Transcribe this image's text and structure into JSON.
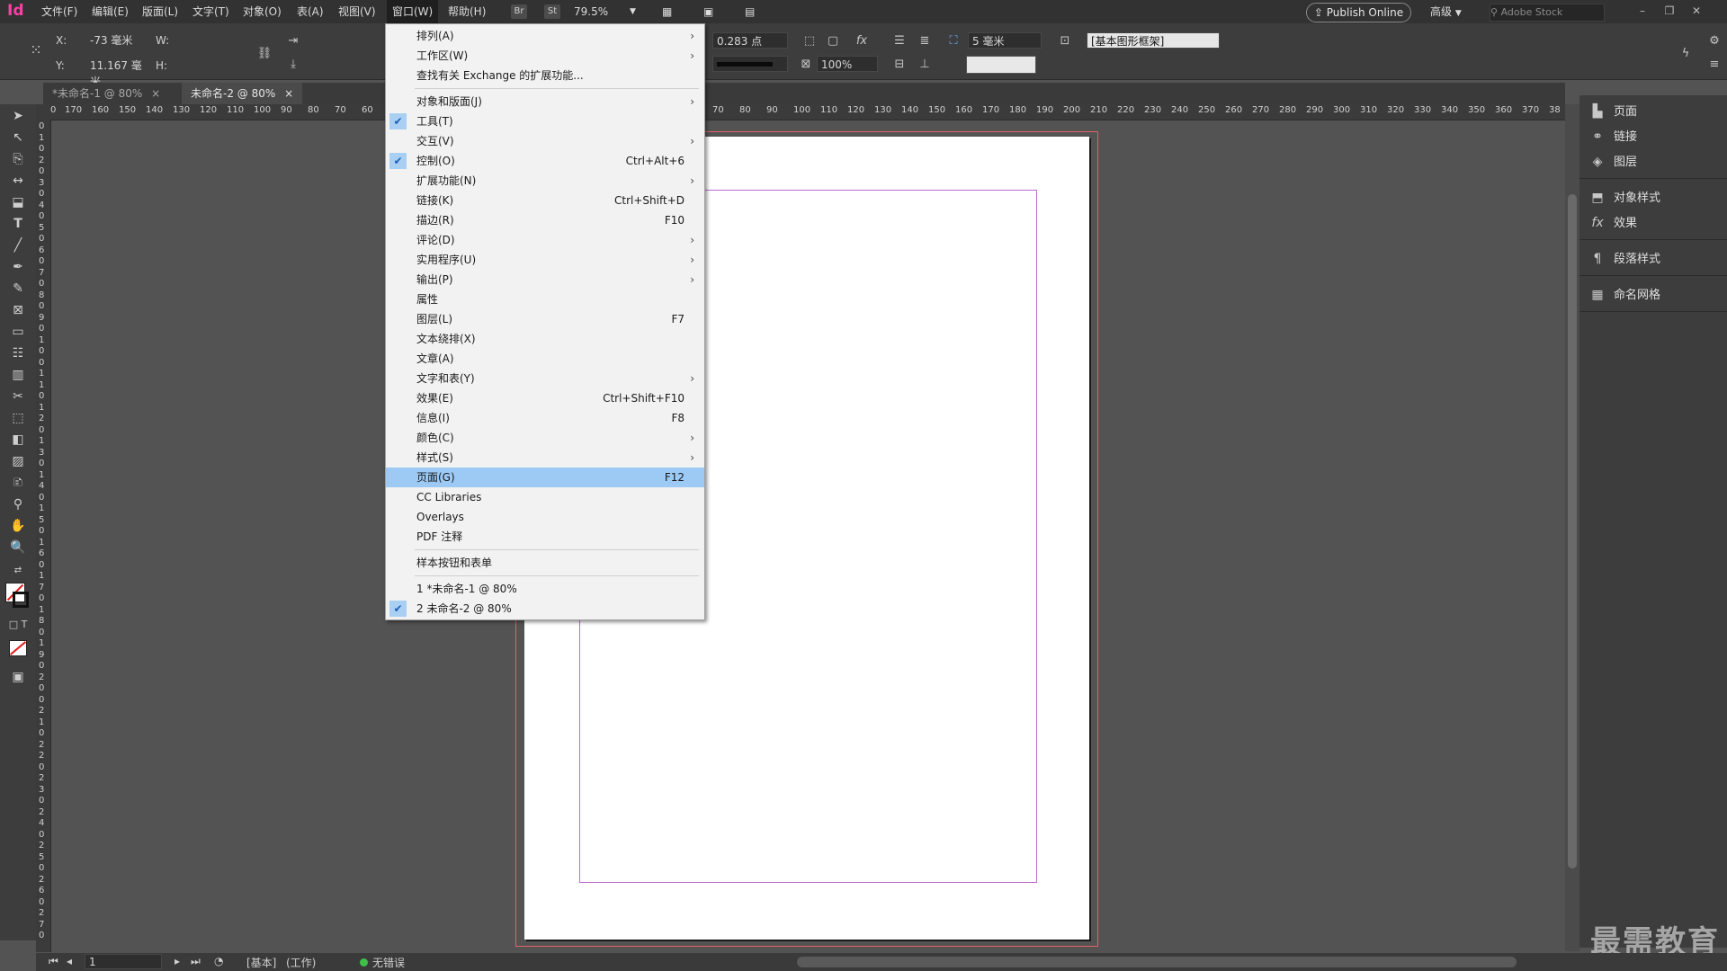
{
  "app": {
    "logo": "Id",
    "menus": [
      "文件(F)",
      "编辑(E)",
      "版面(L)",
      "文字(T)",
      "对象(O)",
      "表(A)",
      "视图(V)",
      "窗口(W)",
      "帮助(H)"
    ],
    "br": "Br",
    "st": "St",
    "zoom": "79.5%",
    "publish_online": "Publish Online",
    "workspace": "高级",
    "search_placeholder": "Adobe Stock"
  },
  "control": {
    "x_label": "X:",
    "x_value": "-73 毫米",
    "y_label": "Y:",
    "y_value": "11.167 毫米",
    "w_label": "W:",
    "h_label": "H:",
    "stroke_weight": "0.283 点",
    "opacity": "100%",
    "offset": "5 毫米",
    "frame_style": "[基本图形框架]"
  },
  "tabs": [
    {
      "label": "*未命名-1 @ 80%",
      "close": "×"
    },
    {
      "label": "未命名-2 @ 80%",
      "close": "×"
    }
  ],
  "ruler_h": [
    "0",
    "170",
    "160",
    "150",
    "140",
    "130",
    "120",
    "110",
    "100",
    "90",
    "80",
    "70",
    "60",
    "70",
    "80",
    "90",
    "100",
    "110",
    "120",
    "130",
    "140",
    "150",
    "160",
    "170",
    "180",
    "190",
    "200",
    "210",
    "220",
    "230",
    "240",
    "250",
    "260",
    "270",
    "280",
    "290",
    "300",
    "310",
    "320",
    "330",
    "340",
    "350",
    "360",
    "370",
    "38"
  ],
  "ruler_v": [
    "0",
    "1",
    "0",
    "2",
    "0",
    "3",
    "0",
    "4",
    "0",
    "5",
    "0",
    "6",
    "0",
    "7",
    "0",
    "8",
    "0",
    "9",
    "0",
    "1",
    "0",
    "0",
    "1",
    "1",
    "0",
    "1",
    "2",
    "0",
    "1",
    "3",
    "0",
    "1",
    "4",
    "0",
    "1",
    "5",
    "0",
    "1",
    "6",
    "0",
    "1",
    "7",
    "0",
    "1",
    "8",
    "0",
    "1",
    "9",
    "0",
    "2",
    "0",
    "0",
    "2",
    "1",
    "0",
    "2",
    "2",
    "0",
    "2",
    "3",
    "0",
    "2",
    "4",
    "0",
    "2",
    "5",
    "0",
    "2",
    "6",
    "0",
    "2",
    "7",
    "0"
  ],
  "window_menu": [
    {
      "label": "排列(A)",
      "submenu": true
    },
    {
      "label": "工作区(W)",
      "submenu": true
    },
    {
      "label": "查找有关 Exchange 的扩展功能..."
    },
    {
      "separator": true
    },
    {
      "label": "对象和版面(J)",
      "submenu": true
    },
    {
      "label": "工具(T)",
      "checked": true
    },
    {
      "label": "交互(V)",
      "submenu": true
    },
    {
      "label": "控制(O)",
      "shortcut": "Ctrl+Alt+6",
      "checked": true
    },
    {
      "label": "扩展功能(N)",
      "submenu": true
    },
    {
      "label": "链接(K)",
      "shortcut": "Ctrl+Shift+D"
    },
    {
      "label": "描边(R)",
      "shortcut": "F10"
    },
    {
      "label": "评论(D)",
      "submenu": true
    },
    {
      "label": "实用程序(U)",
      "submenu": true
    },
    {
      "label": "输出(P)",
      "submenu": true
    },
    {
      "label": "属性"
    },
    {
      "label": "图层(L)",
      "shortcut": "F7"
    },
    {
      "label": "文本绕排(X)"
    },
    {
      "label": "文章(A)"
    },
    {
      "label": "文字和表(Y)",
      "submenu": true
    },
    {
      "label": "效果(E)",
      "shortcut": "Ctrl+Shift+F10"
    },
    {
      "label": "信息(I)",
      "shortcut": "F8"
    },
    {
      "label": "颜色(C)",
      "submenu": true
    },
    {
      "label": "样式(S)",
      "submenu": true
    },
    {
      "label": "页面(G)",
      "shortcut": "F12",
      "highlighted": true
    },
    {
      "label": "CC Libraries"
    },
    {
      "label": "Overlays"
    },
    {
      "label": "PDF 注释"
    },
    {
      "separator": true
    },
    {
      "label": "样本按钮和表单"
    },
    {
      "separator": true
    },
    {
      "label": "1 *未命名-1 @ 80%"
    },
    {
      "label": "2 未命名-2 @ 80%",
      "checked": true
    }
  ],
  "right_panel": {
    "group1": [
      {
        "icon": "pages-icon",
        "label": "页面"
      },
      {
        "icon": "links-icon",
        "label": "链接"
      },
      {
        "icon": "layers-icon",
        "label": "图层"
      }
    ],
    "group2": [
      {
        "icon": "object-styles-icon",
        "label": "对象样式"
      },
      {
        "icon": "fx-icon",
        "label": "效果"
      }
    ],
    "group3": [
      {
        "icon": "paragraph-styles-icon",
        "label": "段落样式"
      }
    ],
    "group4": [
      {
        "icon": "named-grid-icon",
        "label": "命名网格"
      }
    ]
  },
  "status": {
    "page": "1",
    "base": "[基本]",
    "work": "(工作)",
    "errors": "无错误"
  },
  "watermark": "最需教育",
  "colors": {
    "accent_blue": "#9ccaf5",
    "bleed_red": "#e2626a",
    "margin_purple": "#c06ad6",
    "no_error_green": "#3fbf4a"
  }
}
